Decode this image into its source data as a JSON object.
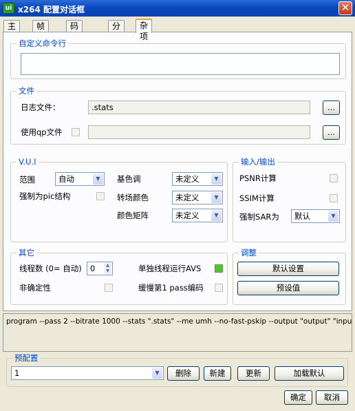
{
  "window": {
    "title": "x264 配置对话框",
    "icon_label": "ui",
    "close_glyph": "✕"
  },
  "tabs": [
    {
      "label": "主要"
    },
    {
      "label": "帧类型"
    },
    {
      "label": "码率控制"
    },
    {
      "label": "分析"
    },
    {
      "label": "杂项"
    }
  ],
  "active_tab": "杂项",
  "custom_cmd": {
    "legend": "自定义命令行",
    "value": ""
  },
  "files": {
    "legend": "文件",
    "log_label": "日志文件：",
    "log_value": ".stats",
    "browse_label": "...",
    "qp_label": "使用qp文件",
    "qp_checked": false,
    "qp_value": "",
    "qp_browse_label": "..."
  },
  "vui": {
    "legend": "V.U.I",
    "range_label": "范围",
    "range_value": "自动",
    "force_pic_label": "强制为pic结构",
    "force_pic_checked": false,
    "primaries_label": "基色调",
    "primaries_value": "未定义",
    "transfer_label": "转场颜色",
    "transfer_value": "未定义",
    "matrix_label": "颜色矩阵",
    "matrix_value": "未定义"
  },
  "io": {
    "legend": "输入/输出",
    "psnr_label": "PSNR计算",
    "psnr_checked": false,
    "ssim_label": "SSIM计算",
    "ssim_checked": false,
    "sar_label": "强制SAR为",
    "sar_value": "默认"
  },
  "misc": {
    "legend": "其它",
    "threads_label": "线程数 (0= 自动)",
    "threads_value": "0",
    "single_thread_label": "单独线程运行AVS",
    "single_thread_checked": true,
    "nondeterministic_label": "非确定性",
    "nondeterministic_checked": false,
    "slow_first_pass_label": "缓慢第1 pass编码",
    "slow_first_pass_checked": false
  },
  "adjust": {
    "legend": "调整",
    "defaults_button": "默认设置",
    "preset_button": "预设值"
  },
  "command_line": "program --pass 2 --bitrate 1000 --stats \".stats\" --me umh --no-fast-pskip --output \"output\" \"input\"",
  "presets": {
    "legend": "预配置",
    "selected": "1",
    "delete_button": "删除",
    "new_button": "新建",
    "update_button": "更新",
    "load_defaults_button": "加载默认"
  },
  "footer": {
    "ok_button": "确定",
    "cancel_button": "取消"
  },
  "colors": {
    "title_bar": "#0a48c0",
    "legend_text": "#0046d5",
    "tab_highlight": "#e6a32a",
    "checked_box": "#4ec23c"
  }
}
